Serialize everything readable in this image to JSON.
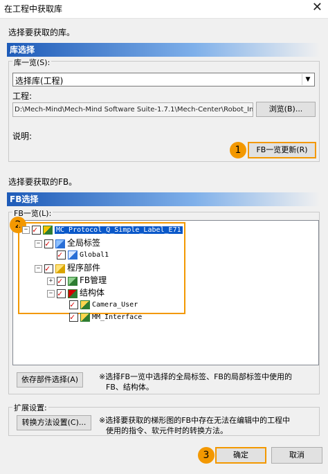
{
  "window": {
    "title": "在工程中获取库",
    "close_glyph": "✕"
  },
  "instruction_lib": "选择要获取的库。",
  "lib_section": {
    "header": "库选择",
    "list_label": "库一览(S):",
    "list_value": "选择库(工程)",
    "project_label": "工程:",
    "project_path": "D:\\Mech-Mind\\Mech-Mind Software Suite-1.7.1\\Mech-Center\\Robot_Inte",
    "browse_button": "浏览(B)...",
    "desc_label": "说明:",
    "update_button": "FB一览更新(R)"
  },
  "instruction_fb": "选择要获取的FB。",
  "fb_section": {
    "header": "FB选择",
    "list_label": "FB一览(L):",
    "tree": [
      {
        "label": "MC_Protocol_Q_Simple_Label_E71",
        "level": 0,
        "expander": "−",
        "icon": "project-icon",
        "selected": true
      },
      {
        "label": "全局标签",
        "level": 1,
        "expander": "−",
        "icon": "global-label-icon",
        "selected": false
      },
      {
        "label": "Global1",
        "level": 2,
        "expander": "",
        "icon": "label-table-icon",
        "selected": false
      },
      {
        "label": "程序部件",
        "level": 1,
        "expander": "−",
        "icon": "program-parts-icon",
        "selected": false
      },
      {
        "label": "FB管理",
        "level": 2,
        "expander": "+",
        "icon": "fb-folder-icon",
        "selected": false
      },
      {
        "label": "结构体",
        "level": 2,
        "expander": "−",
        "icon": "struct-icon",
        "selected": false
      },
      {
        "label": "Camera_User",
        "level": 3,
        "expander": "",
        "icon": "struct-item-icon",
        "selected": false
      },
      {
        "label": "MM_Interface",
        "level": 3,
        "expander": "",
        "icon": "struct-item-icon",
        "selected": false
      }
    ],
    "dependency_button": "依存部件选择(A)",
    "dependency_note_1": "※选择FB一览中选择的全局标签、FB的局部标签中使用的",
    "dependency_note_2": "FB、结构体。"
  },
  "extension": {
    "label": "扩展设置:",
    "convert_button": "转换方法设置(C)...",
    "note_1": "※选择要获取的梯形图的FB中存在无法在编辑中的工程中",
    "note_2": "使用的指令、软元件时的转换方法。"
  },
  "buttons": {
    "ok": "确定",
    "cancel": "取消"
  },
  "callouts": [
    "1",
    "2",
    "3"
  ],
  "colors": {
    "accent": "#f39800",
    "header_blue": "#1e5bb8",
    "selection": "#0a58c9",
    "check_red": "#d40000"
  }
}
